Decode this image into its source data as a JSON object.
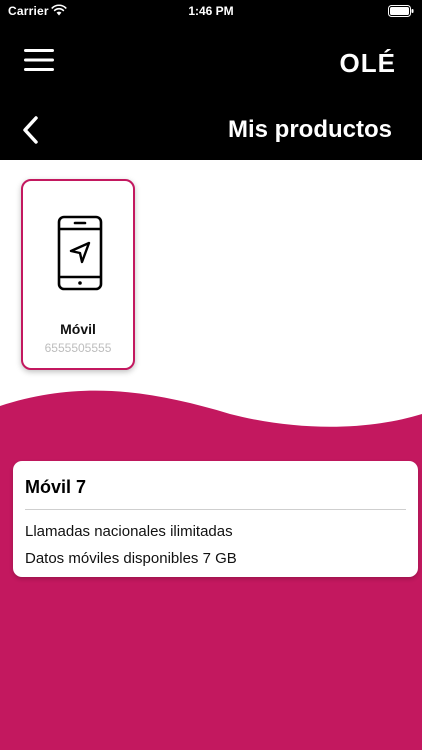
{
  "status_bar": {
    "carrier": "Carrier",
    "time": "1:46 PM"
  },
  "header": {
    "brand": "OLÉ",
    "title": "Mis productos"
  },
  "products": [
    {
      "name": "Móvil",
      "number": "6555505555",
      "icon": "smartphone-location-icon"
    }
  ],
  "plan": {
    "name": "Móvil 7",
    "features": [
      "Llamadas nacionales ilimitadas",
      "Datos móviles disponibles 7 GB"
    ]
  },
  "colors": {
    "header_bg": "#000000",
    "accent": "#c3185f",
    "card_bg": "#ffffff",
    "muted_text": "#bdbdbd"
  }
}
